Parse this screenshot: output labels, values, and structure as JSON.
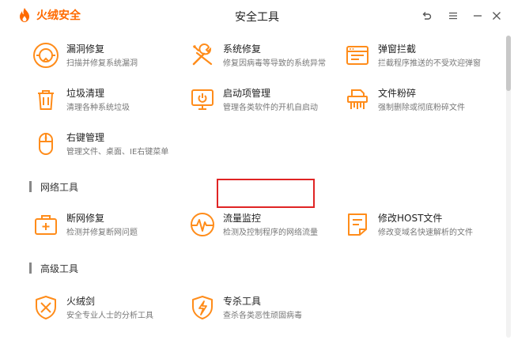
{
  "app": {
    "logo_text": "火绒安全",
    "window_title": "安全工具"
  },
  "colors": {
    "accent": "#ff8c1a",
    "highlight": "#e02424"
  },
  "window_controls": [
    {
      "name": "back-icon"
    },
    {
      "name": "menu-icon"
    },
    {
      "name": "minimize-icon"
    },
    {
      "name": "close-icon"
    }
  ],
  "system_tools": [
    {
      "name": "漏洞修复",
      "desc": "扫描并修复系统漏洞",
      "icon": "vulnerability-fix-icon"
    },
    {
      "name": "系统修复",
      "desc": "修复因病毒等导致的系统异常",
      "icon": "system-repair-icon"
    },
    {
      "name": "弹窗拦截",
      "desc": "拦截程序推送的不受欢迎弹窗",
      "icon": "popup-block-icon"
    },
    {
      "name": "垃圾清理",
      "desc": "清理各种系统垃圾",
      "icon": "trash-icon"
    },
    {
      "name": "启动项管理",
      "desc": "管理各类软件的开机自启动",
      "icon": "startup-icon"
    },
    {
      "name": "文件粉碎",
      "desc": "强制删除或彻底粉碎文件",
      "icon": "shredder-icon"
    },
    {
      "name": "右键管理",
      "desc": "管理文件、桌面、IE右键菜单",
      "icon": "mouse-icon"
    }
  ],
  "sections": {
    "network": "网络工具",
    "advanced": "高级工具"
  },
  "network_tools": [
    {
      "name": "断网修复",
      "desc": "检测并修复断网问题",
      "icon": "network-repair-icon"
    },
    {
      "name": "流量监控",
      "desc": "检测及控制程序的网络流量",
      "icon": "traffic-monitor-icon"
    },
    {
      "name": "修改HOST文件",
      "desc": "修改变域名快速解析的文件",
      "icon": "host-file-icon"
    }
  ],
  "advanced_tools": [
    {
      "name": "火绒剑",
      "desc": "安全专业人士的分析工具",
      "icon": "sword-shield-icon"
    },
    {
      "name": "专杀工具",
      "desc": "查杀各类恶性顽固病毒",
      "icon": "special-kill-icon"
    }
  ]
}
